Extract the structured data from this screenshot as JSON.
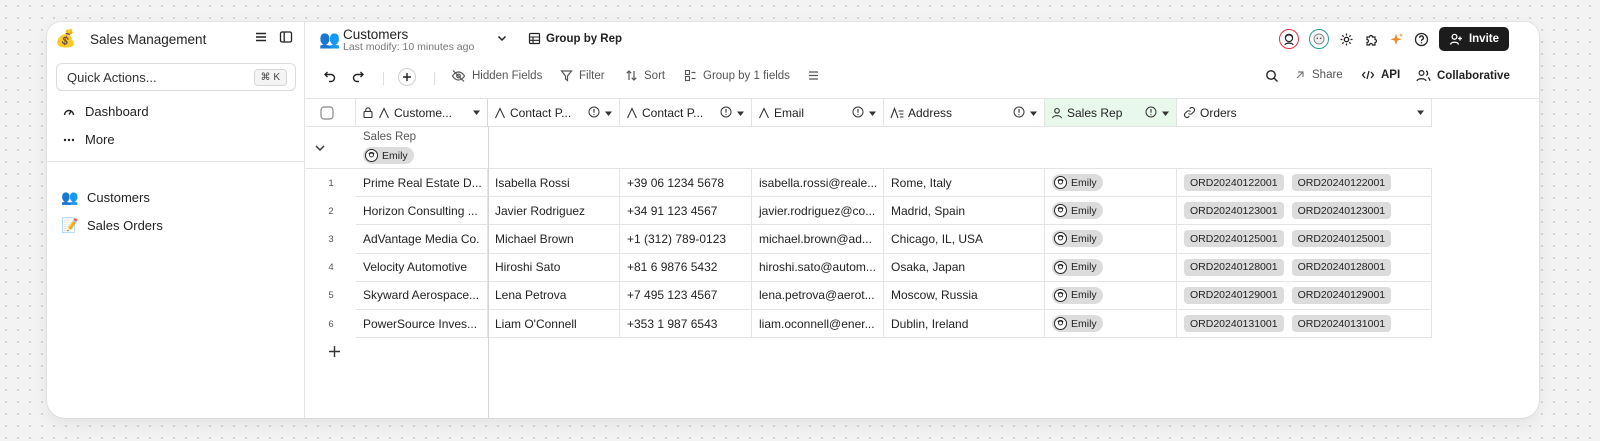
{
  "app": {
    "title": "Sales Management",
    "logo_icon": "money-bag-icon"
  },
  "quick_actions": {
    "placeholder": "Quick Actions...",
    "shortcut": "⌘ K"
  },
  "nav": [
    {
      "label": "Dashboard",
      "icon": "gauge-icon"
    },
    {
      "label": "More",
      "icon": "more-icon"
    }
  ],
  "tables": [
    {
      "label": "Customers",
      "icon": "busts-emoji"
    },
    {
      "label": "Sales Orders",
      "icon": "memo-emoji"
    }
  ],
  "topbar": {
    "table_name": "Customers",
    "last_modified": "Last modify: 10 minutes ago",
    "view_name": "Group by Rep",
    "invite_label": "Invite"
  },
  "toolbar": {
    "hidden_fields": "Hidden Fields",
    "filter": "Filter",
    "sort": "Sort",
    "group_by": "Group by 1 fields",
    "share": "Share",
    "api": "API",
    "collaborative": "Collaborative"
  },
  "columns": [
    {
      "label": "Custome...",
      "icon": "text-icon"
    },
    {
      "label": "Contact P...",
      "icon": "text-icon"
    },
    {
      "label": "Contact P...",
      "icon": "text-icon"
    },
    {
      "label": "Email",
      "icon": "text-icon"
    },
    {
      "label": "Address",
      "icon": "long-text-icon"
    },
    {
      "label": "Sales Rep",
      "icon": "user-icon"
    },
    {
      "label": "Orders",
      "icon": "link-icon"
    }
  ],
  "group": {
    "field": "Sales Rep",
    "value": "Emily"
  },
  "rows": [
    {
      "num": "1",
      "customer": "Prime Real Estate D...",
      "contact_person": "Isabella Rossi",
      "contact_phone": "+39 06 1234 5678",
      "email": "isabella.rossi@reale...",
      "address": "Rome, Italy",
      "rep": "Emily",
      "orders": [
        "ORD20240122001",
        "ORD20240122001"
      ]
    },
    {
      "num": "2",
      "customer": "Horizon Consulting ...",
      "contact_person": "Javier Rodriguez",
      "contact_phone": "+34 91 123 4567",
      "email": "javier.rodriguez@co...",
      "address": "Madrid, Spain",
      "rep": "Emily",
      "orders": [
        "ORD20240123001",
        "ORD20240123001"
      ]
    },
    {
      "num": "3",
      "customer": "AdVantage Media Co.",
      "contact_person": "Michael Brown",
      "contact_phone": "+1 (312) 789-0123",
      "email": "michael.brown@ad...",
      "address": "Chicago, IL, USA",
      "rep": "Emily",
      "orders": [
        "ORD20240125001",
        "ORD20240125001"
      ]
    },
    {
      "num": "4",
      "customer": "Velocity Automotive",
      "contact_person": "Hiroshi Sato",
      "contact_phone": "+81 6 9876 5432",
      "email": "hiroshi.sato@autom...",
      "address": "Osaka, Japan",
      "rep": "Emily",
      "orders": [
        "ORD20240128001",
        "ORD20240128001"
      ]
    },
    {
      "num": "5",
      "customer": "Skyward Aerospace...",
      "contact_person": "Lena Petrova",
      "contact_phone": "+7 495 123 4567",
      "email": "lena.petrova@aerot...",
      "address": "Moscow, Russia",
      "rep": "Emily",
      "orders": [
        "ORD20240129001",
        "ORD20240129001"
      ]
    },
    {
      "num": "6",
      "customer": "PowerSource Inves...",
      "contact_person": "Liam O'Connell",
      "contact_phone": "+353 1 987 6543",
      "email": "liam.oconnell@ener...",
      "address": "Dublin, Ireland",
      "rep": "Emily",
      "orders": [
        "ORD20240131001",
        "ORD20240131001"
      ]
    }
  ],
  "colors": {
    "active_column_bg": "#e8f8eb",
    "invite_bg": "#1c1c1c",
    "accent_orange": "#f08a24"
  }
}
